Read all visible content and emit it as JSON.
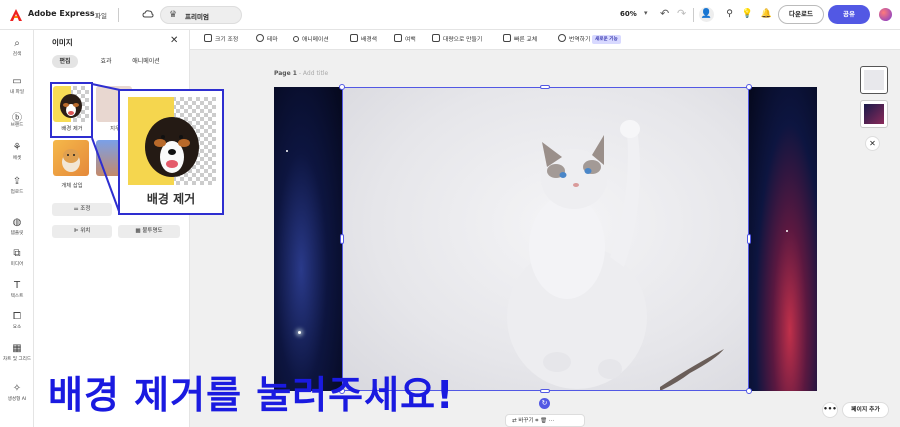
{
  "app": {
    "name": "Adobe Express",
    "file_menu": "파일",
    "trial_label": "프리미엄"
  },
  "toolbar": {
    "zoom": "60%",
    "download_label": "다운로드",
    "share_label": "공유"
  },
  "rail": [
    {
      "id": "search",
      "label": "검색",
      "icon": "search-icon"
    },
    {
      "id": "my-files",
      "label": "내 파일",
      "icon": "folder-icon"
    },
    {
      "id": "brand",
      "label": "브랜드",
      "icon": "brand-icon"
    },
    {
      "id": "assets",
      "label": "에셋",
      "icon": "assets-icon"
    },
    {
      "id": "upload",
      "label": "업로드",
      "icon": "upload-icon"
    },
    {
      "id": "templates",
      "label": "템플릿",
      "icon": "template-icon"
    },
    {
      "id": "media",
      "label": "미디어",
      "icon": "media-icon"
    },
    {
      "id": "text",
      "label": "텍스트",
      "icon": "text-icon"
    },
    {
      "id": "elements",
      "label": "요소",
      "icon": "elements-icon"
    },
    {
      "id": "charts",
      "label": "차트 및 그리드",
      "icon": "chart-icon"
    },
    {
      "id": "gen-ai",
      "label": "생성형 AI",
      "icon": "gen-ai-icon"
    }
  ],
  "panel": {
    "title": "이미지",
    "tabs": [
      {
        "label": "편집",
        "active": true
      },
      {
        "label": "효과",
        "active": false
      },
      {
        "label": "애니메이션",
        "active": false
      }
    ],
    "tiles": [
      {
        "label": "배경 제거"
      },
      {
        "label": "지우"
      },
      {
        "label": "개체 삽입"
      }
    ],
    "buttons": {
      "adjust": "조정",
      "position": "위치",
      "opacity": "불투명도"
    }
  },
  "context_toolbar": [
    {
      "label": "크기 조정"
    },
    {
      "label": "테마"
    },
    {
      "label": "애니메이션"
    },
    {
      "label": "배경색"
    },
    {
      "label": "여백"
    },
    {
      "label": "대량으로 만들기"
    },
    {
      "label": "빠른 교체"
    },
    {
      "label": "번역하기"
    }
  ],
  "new_badge": "새로운 기능",
  "canvas": {
    "page_label": "Page 1",
    "page_title_placeholder": "- Add title"
  },
  "bottom": {
    "more_label": "•••",
    "add_page_label": "페이지 추가",
    "replace_label": "바꾸기"
  },
  "callout": {
    "caption": "배경 제거"
  },
  "subtitle": "배경 제거를 눌러주세요!",
  "colors": {
    "accent": "#5258e4",
    "highlight": "#2e2ed0",
    "subtitle": "#1a1ae0"
  }
}
